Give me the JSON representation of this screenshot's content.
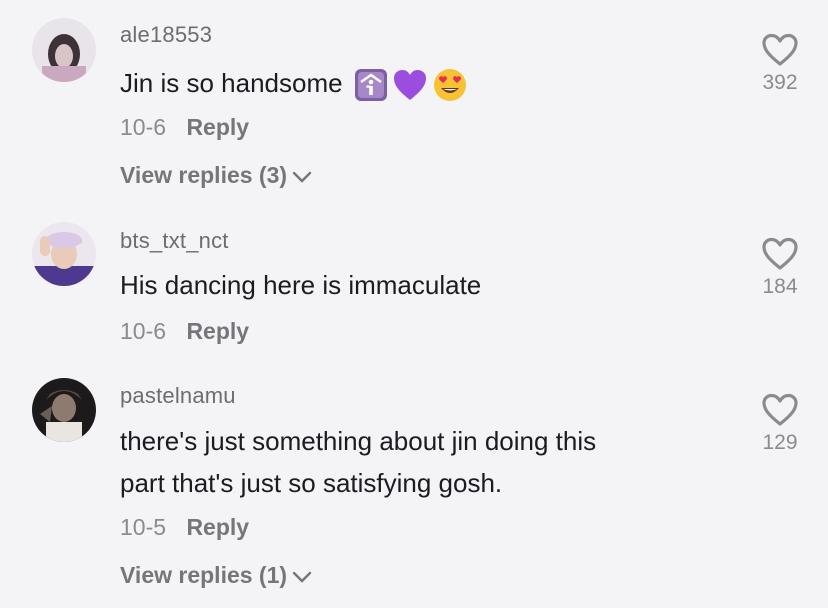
{
  "comments": [
    {
      "username": "ale18553",
      "text": "Jin is so handsome",
      "emojis": [
        "person-info-icon",
        "purple-heart-icon",
        "heart-eyes-icon"
      ],
      "date": "10-6",
      "reply_label": "Reply",
      "view_replies": "View replies (3)",
      "likes": "392"
    },
    {
      "username": "bts_txt_nct",
      "text": "His dancing here is immaculate",
      "date": "10-6",
      "reply_label": "Reply",
      "likes": "184"
    },
    {
      "username": "pastelnamu",
      "text_line1": "there's just something about jin doing this",
      "text_line2": "part that's just so satisfying gosh.",
      "date": "10-5",
      "reply_label": "Reply",
      "view_replies": "View replies (1)",
      "likes": "129"
    }
  ],
  "colors": {
    "background": "#f4f3f6",
    "username": "#6c6c72",
    "text": "#1b1b22",
    "meta": "#8a8a90",
    "purple_heart": "#9b4de0"
  }
}
